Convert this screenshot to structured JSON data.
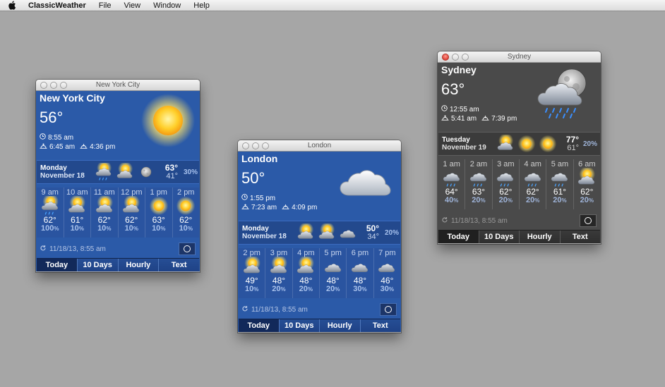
{
  "menubar": {
    "app": "ClassicWeather",
    "items": [
      "File",
      "View",
      "Window",
      "Help"
    ]
  },
  "windows": {
    "nyc": {
      "title": "New York City",
      "city": "New York City",
      "temp": "56°",
      "time": "8:55 am",
      "sunrise": "6:45 am",
      "sunset": "4:36 pm",
      "day": {
        "name": "Monday",
        "date": "November 18",
        "hi": "63°",
        "lo": "41°",
        "pct": "30%"
      },
      "hours": [
        {
          "label": "9 am",
          "temp": "62°",
          "pct": "100",
          "icon": "cloud-sun-rain-icon"
        },
        {
          "label": "10 am",
          "temp": "61°",
          "pct": "10",
          "icon": "sun-cloud-icon"
        },
        {
          "label": "11 am",
          "temp": "62°",
          "pct": "10",
          "icon": "sun-cloud-icon"
        },
        {
          "label": "12 pm",
          "temp": "62°",
          "pct": "10",
          "icon": "sun-cloud-icon"
        },
        {
          "label": "1 pm",
          "temp": "63°",
          "pct": "10",
          "icon": "sun-icon"
        },
        {
          "label": "2 pm",
          "temp": "62°",
          "pct": "10",
          "icon": "sun-icon"
        }
      ],
      "updated": "11/18/13, 8:55 am"
    },
    "london": {
      "title": "London",
      "city": "London",
      "temp": "50°",
      "time": "1:55 pm",
      "sunrise": "7:23 am",
      "sunset": "4:09 pm",
      "day": {
        "name": "Monday",
        "date": "November 18",
        "hi": "50°",
        "lo": "34°",
        "pct": "20%"
      },
      "hours": [
        {
          "label": "2 pm",
          "temp": "49°",
          "pct": "10",
          "icon": "sun-cloud-icon"
        },
        {
          "label": "3 pm",
          "temp": "48°",
          "pct": "20",
          "icon": "sun-cloud-icon"
        },
        {
          "label": "4 pm",
          "temp": "48°",
          "pct": "20",
          "icon": "sun-cloud-icon"
        },
        {
          "label": "5 pm",
          "temp": "48°",
          "pct": "20",
          "icon": "cloud-icon"
        },
        {
          "label": "6 pm",
          "temp": "48°",
          "pct": "30",
          "icon": "cloud-icon"
        },
        {
          "label": "7 pm",
          "temp": "46°",
          "pct": "30",
          "icon": "cloud-icon"
        }
      ],
      "updated": "11/18/13, 8:55 am"
    },
    "sydney": {
      "title": "Sydney",
      "city": "Sydney",
      "temp": "63°",
      "time": "12:55 am",
      "sunrise": "5:41 am",
      "sunset": "7:39 pm",
      "day": {
        "name": "Tuesday",
        "date": "November 19",
        "hi": "77°",
        "lo": "61°",
        "pct": "20%"
      },
      "hours": [
        {
          "label": "1 am",
          "temp": "64°",
          "pct": "40",
          "icon": "cloud-rain-icon"
        },
        {
          "label": "2 am",
          "temp": "63°",
          "pct": "20",
          "icon": "cloud-rain-icon"
        },
        {
          "label": "3 am",
          "temp": "62°",
          "pct": "20",
          "icon": "cloud-rain-icon"
        },
        {
          "label": "4 am",
          "temp": "62°",
          "pct": "20",
          "icon": "cloud-rain-icon"
        },
        {
          "label": "5 am",
          "temp": "61°",
          "pct": "20",
          "icon": "cloud-rain-icon"
        },
        {
          "label": "6 am",
          "temp": "62°",
          "pct": "20",
          "icon": "sun-cloud-icon"
        }
      ],
      "updated": "11/18/13, 8:55 am"
    }
  },
  "tabs": [
    "Today",
    "10 Days",
    "Hourly",
    "Text"
  ]
}
